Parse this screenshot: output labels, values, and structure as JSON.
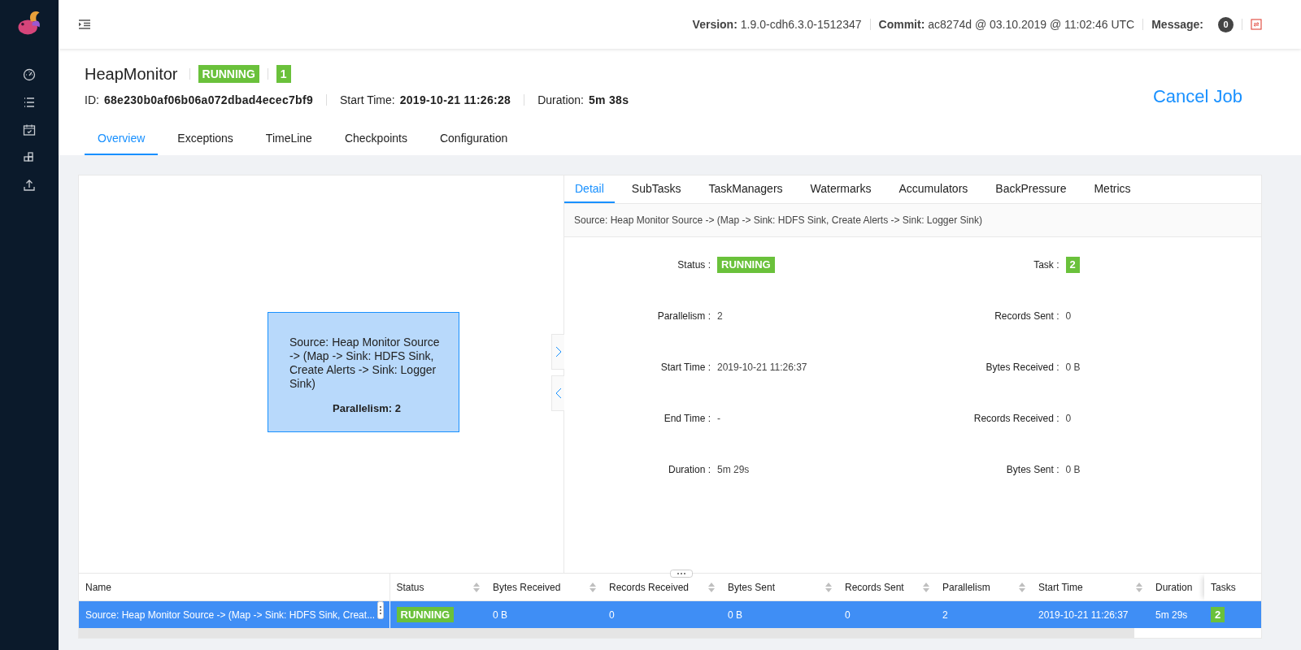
{
  "header": {
    "version_label": "Version:",
    "version": "1.9.0-cdh6.3.0-1512347",
    "commit_label": "Commit:",
    "commit": "ac8274d @ 03.10.2019 @ 11:02:46 UTC",
    "message_label": "Message:",
    "message_count": "0"
  },
  "job": {
    "name": "HeapMonitor",
    "status": "RUNNING",
    "task_count": "1",
    "id_label": "ID:",
    "id": "68e230b0af06b06a072dbad4ecec7bf9",
    "start_label": "Start Time:",
    "start": "2019-10-21 11:26:28",
    "duration_label": "Duration:",
    "duration": "5m 38s",
    "cancel": "Cancel Job"
  },
  "tabs": [
    {
      "label": "Overview",
      "selected": true
    },
    {
      "label": "Exceptions",
      "selected": false
    },
    {
      "label": "TimeLine",
      "selected": false
    },
    {
      "label": "Checkpoints",
      "selected": false
    },
    {
      "label": "Configuration",
      "selected": false
    }
  ],
  "graph_node": {
    "title": "Source: Heap Monitor Source -> (Map -> Sink: HDFS Sink, Create Alerts -> Sink: Logger Sink)",
    "parallelism": "Parallelism: 2"
  },
  "detail_tabs": [
    {
      "label": "Detail",
      "selected": true
    },
    {
      "label": "SubTasks",
      "selected": false
    },
    {
      "label": "TaskManagers",
      "selected": false
    },
    {
      "label": "Watermarks",
      "selected": false
    },
    {
      "label": "Accumulators",
      "selected": false
    },
    {
      "label": "BackPressure",
      "selected": false
    },
    {
      "label": "Metrics",
      "selected": false
    }
  ],
  "vertex_name": "Source: Heap Monitor Source -> (Map -> Sink: HDFS Sink, Create Alerts -> Sink: Logger Sink)",
  "details": [
    {
      "label": "Status :",
      "value": "RUNNING",
      "kind": "badge"
    },
    {
      "label": "Task :",
      "value": "2",
      "kind": "badge"
    },
    {
      "label": "Parallelism :",
      "value": "2",
      "kind": "text"
    },
    {
      "label": "Records Sent :",
      "value": "0",
      "kind": "text"
    },
    {
      "label": "Start Time :",
      "value": "2019-10-21 11:26:37",
      "kind": "text"
    },
    {
      "label": "Bytes Received :",
      "value": "0 B",
      "kind": "text"
    },
    {
      "label": "End Time :",
      "value": "-",
      "kind": "text"
    },
    {
      "label": "Records Received :",
      "value": "0",
      "kind": "text"
    },
    {
      "label": "Duration :",
      "value": "5m 29s",
      "kind": "text"
    },
    {
      "label": "Bytes Sent :",
      "value": "0 B",
      "kind": "text"
    }
  ],
  "table": {
    "columns": [
      {
        "label": "Name",
        "sortable": false
      },
      {
        "label": "Status",
        "sortable": true
      },
      {
        "label": "Bytes Received",
        "sortable": true
      },
      {
        "label": "Records Received",
        "sortable": true
      },
      {
        "label": "Bytes Sent",
        "sortable": true
      },
      {
        "label": "Records Sent",
        "sortable": true
      },
      {
        "label": "Parallelism",
        "sortable": true
      },
      {
        "label": "Start Time",
        "sortable": true
      },
      {
        "label": "Duration",
        "sortable": false
      },
      {
        "label": "Tasks",
        "sortable": false
      }
    ],
    "rows": [
      {
        "selected": true,
        "cells": [
          {
            "kind": "text",
            "value": "Source: Heap Monitor Source -> (Map -> Sink: HDFS Sink, Creat..."
          },
          {
            "kind": "badge",
            "value": "RUNNING"
          },
          {
            "kind": "text",
            "value": "0 B"
          },
          {
            "kind": "text",
            "value": "0"
          },
          {
            "kind": "text",
            "value": "0 B"
          },
          {
            "kind": "text",
            "value": "0"
          },
          {
            "kind": "text",
            "value": "2"
          },
          {
            "kind": "text",
            "value": "2019-10-21 11:26:37"
          },
          {
            "kind": "text",
            "value": "5m 29s"
          },
          {
            "kind": "badge",
            "value": "2"
          }
        ]
      }
    ]
  }
}
